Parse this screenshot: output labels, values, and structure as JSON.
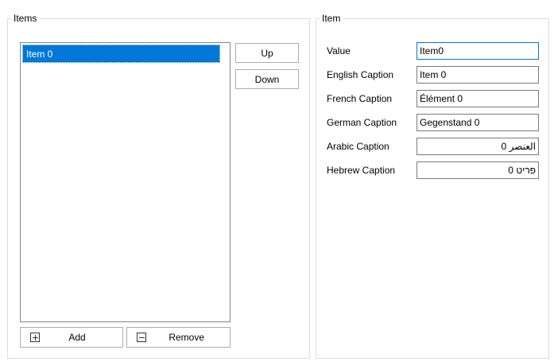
{
  "items_group": {
    "title": "Items",
    "list": [
      "Item 0"
    ],
    "up_label": "Up",
    "down_label": "Down",
    "add_label": "Add",
    "remove_label": "Remove"
  },
  "item_group": {
    "title": "Item",
    "fields": [
      {
        "label": "Value",
        "value": "Item0"
      },
      {
        "label": "English Caption",
        "value": "Item 0"
      },
      {
        "label": "French Caption",
        "value": "Élément 0"
      },
      {
        "label": "German Caption",
        "value": "Gegenstand 0"
      },
      {
        "label": "Arabic Caption",
        "value": "العنصر 0"
      },
      {
        "label": "Hebrew Caption",
        "value": "פריט 0"
      }
    ]
  },
  "colors": {
    "selection": "#0078d7",
    "border": "#dcdcdc",
    "button_border": "#adadad"
  },
  "icons": {
    "add": "plus-box-icon",
    "remove": "minus-box-icon"
  }
}
